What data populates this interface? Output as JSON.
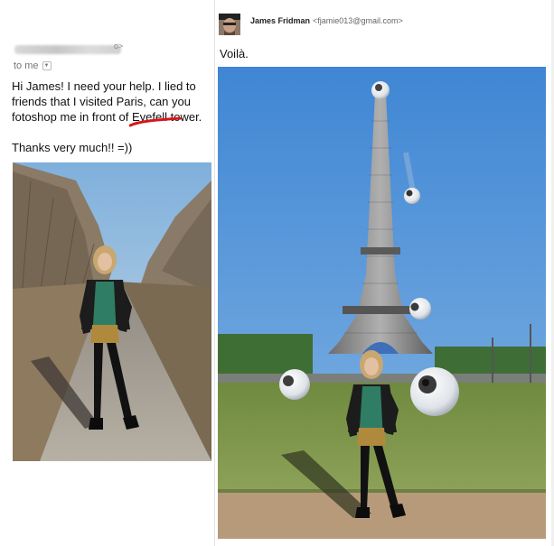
{
  "left_email": {
    "sender_tail": "o>",
    "recipient_label": "to me",
    "body_lines": {
      "p1_a": "Hi James! I need your help. I lied to friends that I visited Paris, can you fotoshop me in front of ",
      "p1_typo": "Eyefell",
      "p1_b": " tower.",
      "p2": "Thanks very much!! =))"
    }
  },
  "right_email": {
    "sender_name": "James Fridman",
    "sender_email": "<fjamie013@gmail.com>",
    "body": "Voilà."
  },
  "icons": {
    "dropdown": "chevron-down-icon",
    "avatar": "user-avatar"
  },
  "colors": {
    "typo_underline": "#d6161a",
    "sky": "#5a9ad8",
    "grass": "#7f9a4a"
  }
}
